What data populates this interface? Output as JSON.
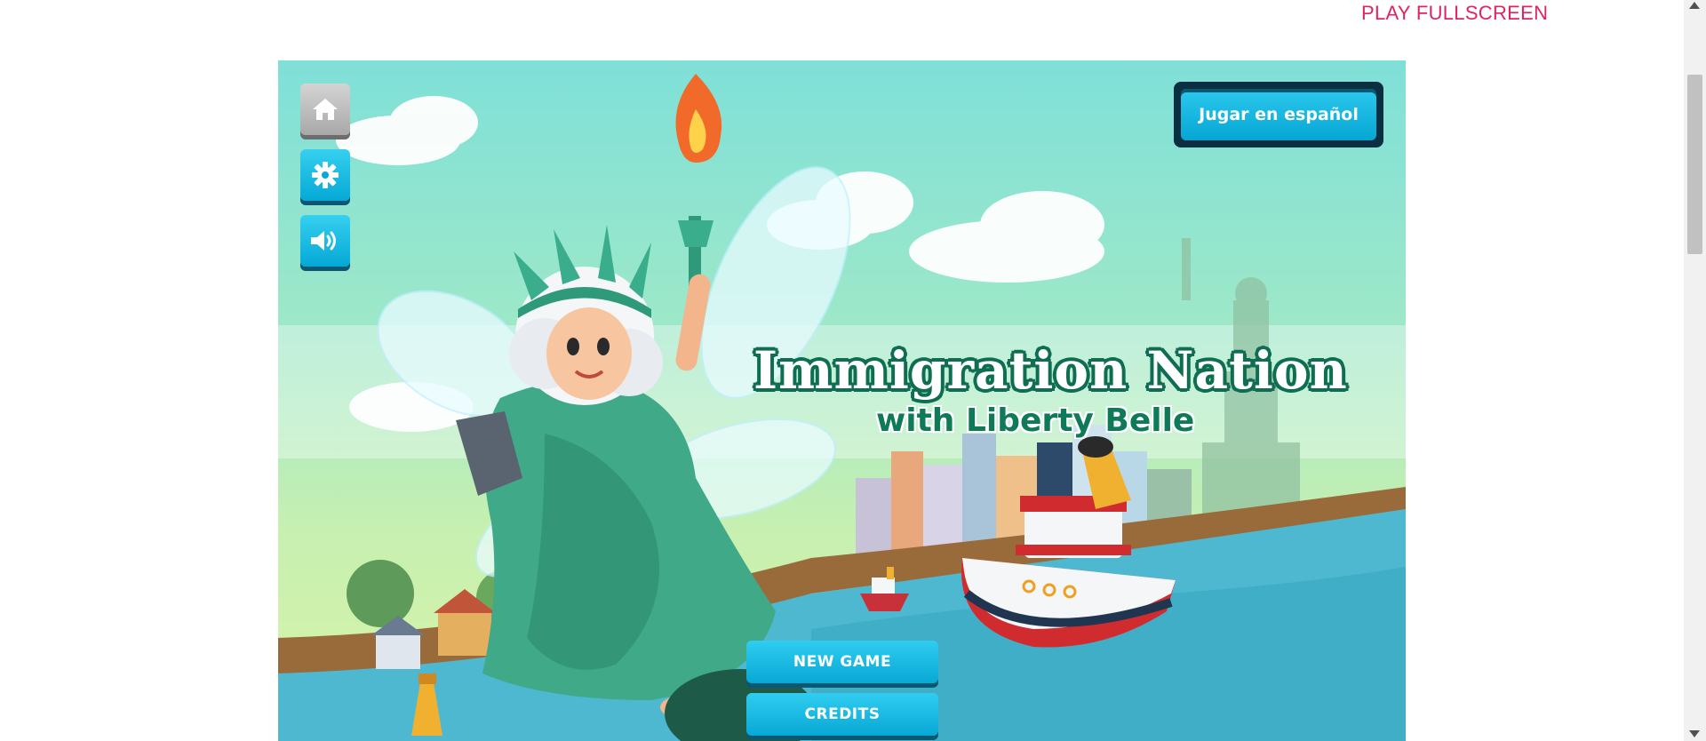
{
  "page": {
    "fullscreen_label": "PLAY FULLSCREEN"
  },
  "game": {
    "title": "Immigration Nation",
    "subtitle": "with Liberty Belle",
    "language_button": "Jugar en español",
    "menu": {
      "new_game": "NEW GAME",
      "credits": "CREDITS"
    },
    "side_buttons": [
      {
        "name": "home",
        "icon": "house-icon"
      },
      {
        "name": "settings",
        "icon": "gear-icon"
      },
      {
        "name": "sound",
        "icon": "speaker-icon"
      }
    ]
  },
  "colors": {
    "link": "#e0245e",
    "button_blue": "#08a8d6",
    "button_shadow": "#0a5872",
    "title_green": "#0f6e52",
    "sky": "#7fe0d8",
    "water": "#4db8d0"
  }
}
